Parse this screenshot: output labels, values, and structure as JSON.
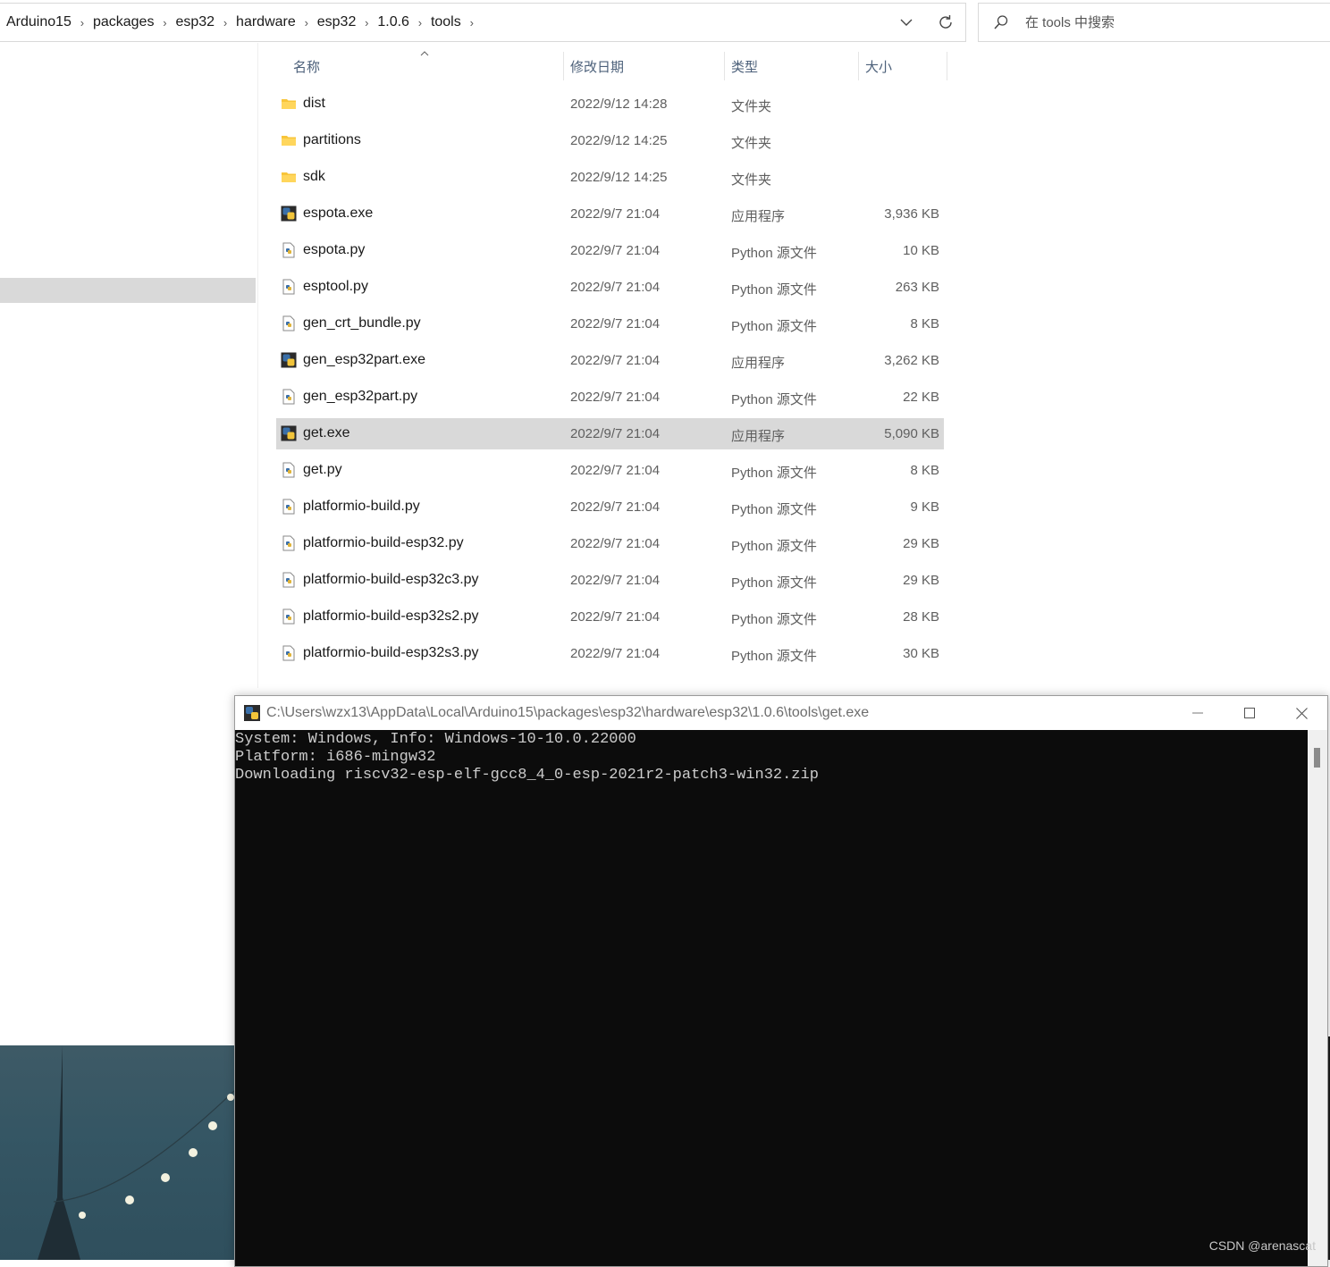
{
  "breadcrumb": [
    "Arduino15",
    "packages",
    "esp32",
    "hardware",
    "esp32",
    "1.0.6",
    "tools"
  ],
  "search": {
    "placeholder": "在 tools 中搜索"
  },
  "columns": {
    "name": "名称",
    "date": "修改日期",
    "type": "类型",
    "size": "大小"
  },
  "files": [
    {
      "name": "dist",
      "date": "2022/9/12 14:28",
      "type": "文件夹",
      "size": "",
      "icon": "folder-icon"
    },
    {
      "name": "partitions",
      "date": "2022/9/12 14:25",
      "type": "文件夹",
      "size": "",
      "icon": "folder-icon"
    },
    {
      "name": "sdk",
      "date": "2022/9/12 14:25",
      "type": "文件夹",
      "size": "",
      "icon": "folder-icon"
    },
    {
      "name": "espota.exe",
      "date": "2022/9/7 21:04",
      "type": "应用程序",
      "size": "3,936 KB",
      "icon": "python-exe-icon"
    },
    {
      "name": "espota.py",
      "date": "2022/9/7 21:04",
      "type": "Python 源文件",
      "size": "10 KB",
      "icon": "python-file-icon"
    },
    {
      "name": "esptool.py",
      "date": "2022/9/7 21:04",
      "type": "Python 源文件",
      "size": "263 KB",
      "icon": "python-file-icon"
    },
    {
      "name": "gen_crt_bundle.py",
      "date": "2022/9/7 21:04",
      "type": "Python 源文件",
      "size": "8 KB",
      "icon": "python-file-icon"
    },
    {
      "name": "gen_esp32part.exe",
      "date": "2022/9/7 21:04",
      "type": "应用程序",
      "size": "3,262 KB",
      "icon": "python-exe-icon"
    },
    {
      "name": "gen_esp32part.py",
      "date": "2022/9/7 21:04",
      "type": "Python 源文件",
      "size": "22 KB",
      "icon": "python-file-icon"
    },
    {
      "name": "get.exe",
      "date": "2022/9/7 21:04",
      "type": "应用程序",
      "size": "5,090 KB",
      "icon": "python-exe-icon",
      "selected": true
    },
    {
      "name": "get.py",
      "date": "2022/9/7 21:04",
      "type": "Python 源文件",
      "size": "8 KB",
      "icon": "python-file-icon"
    },
    {
      "name": "platformio-build.py",
      "date": "2022/9/7 21:04",
      "type": "Python 源文件",
      "size": "9 KB",
      "icon": "python-file-icon"
    },
    {
      "name": "platformio-build-esp32.py",
      "date": "2022/9/7 21:04",
      "type": "Python 源文件",
      "size": "29 KB",
      "icon": "python-file-icon"
    },
    {
      "name": "platformio-build-esp32c3.py",
      "date": "2022/9/7 21:04",
      "type": "Python 源文件",
      "size": "29 KB",
      "icon": "python-file-icon"
    },
    {
      "name": "platformio-build-esp32s2.py",
      "date": "2022/9/7 21:04",
      "type": "Python 源文件",
      "size": "28 KB",
      "icon": "python-file-icon"
    },
    {
      "name": "platformio-build-esp32s3.py",
      "date": "2022/9/7 21:04",
      "type": "Python 源文件",
      "size": "30 KB",
      "icon": "python-file-icon"
    }
  ],
  "console": {
    "title": "C:\\Users\\wzx13\\AppData\\Local\\Arduino15\\packages\\esp32\\hardware\\esp32\\1.0.6\\tools\\get.exe",
    "lines": [
      "System: Windows, Info: Windows-10-10.0.22000",
      "Platform: i686-mingw32",
      "Downloading riscv32-esp-elf-gcc8_4_0-esp-2021r2-patch3-win32.zip"
    ]
  },
  "watermark": "CSDN @arenascat",
  "colors": {
    "selection": "#d9d9d9",
    "console_bg": "#0c0c0c",
    "console_text": "#cccccc",
    "header_text": "#4c607a"
  }
}
